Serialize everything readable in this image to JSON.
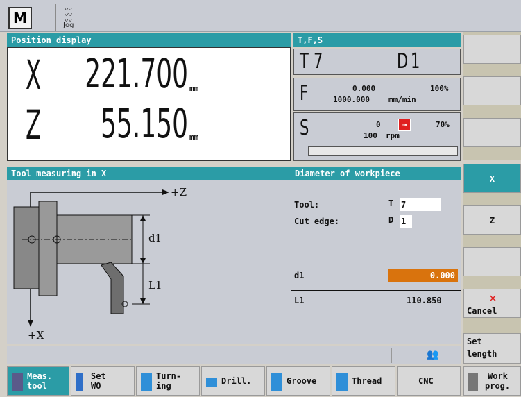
{
  "topbar": {
    "mode_m": "M",
    "mode_jog_label": "Jog",
    "mode_jog_wave": "~\n~\n~"
  },
  "position": {
    "header": "Position display",
    "x_axis": "X",
    "x_value": "221.700",
    "x_unit": "mm",
    "z_axis": "Z",
    "z_value": "55.150",
    "z_unit": "mm"
  },
  "tfs": {
    "header": "T,F,S",
    "t_label": "T",
    "t_value": "7",
    "d_label": "D",
    "d_value": "1",
    "f_label": "F",
    "f_value": "0.000",
    "f_override": "100%",
    "f_rate": "1000.000",
    "f_unit": "mm/min",
    "s_label": "S",
    "s_value": "0",
    "s_override": "70%",
    "s_set": "100",
    "s_unit": "rpm"
  },
  "tool_measure": {
    "header": "Tool measuring in X",
    "diagram": {
      "z_axis": "+Z",
      "x_axis": "+X",
      "d1": "d1",
      "l1": "L1"
    }
  },
  "diameter": {
    "header": "Diameter of workpiece",
    "tool_label": "Tool:",
    "tool_prefix": "T",
    "tool_value": "7",
    "edge_label": "Cut edge:",
    "edge_prefix": "D",
    "edge_value": "1",
    "d1_label": "d1",
    "d1_value": "0.000",
    "l1_label": "L1",
    "l1_value": "110.850"
  },
  "right_softkeys": {
    "x": "X",
    "z": "Z",
    "cancel": "Cancel",
    "set_length_1": "Set",
    "set_length_2": "length"
  },
  "bottom_softkeys": [
    {
      "line1": "Meas.",
      "line2": "tool"
    },
    {
      "line1": "Set",
      "line2": "WO"
    },
    {
      "line1": "Turn-",
      "line2": "ing"
    },
    {
      "line1": "Drill.",
      "line2": ""
    },
    {
      "line1": "Groove",
      "line2": ""
    },
    {
      "line1": "Thread",
      "line2": ""
    },
    {
      "line1": "CNC",
      "line2": ""
    },
    {
      "line1": "Work",
      "line2": "prog."
    }
  ],
  "colors": {
    "accent": "#2b9ca6",
    "highlight_input": "#d9730d",
    "cancel_red": "#e02020"
  }
}
